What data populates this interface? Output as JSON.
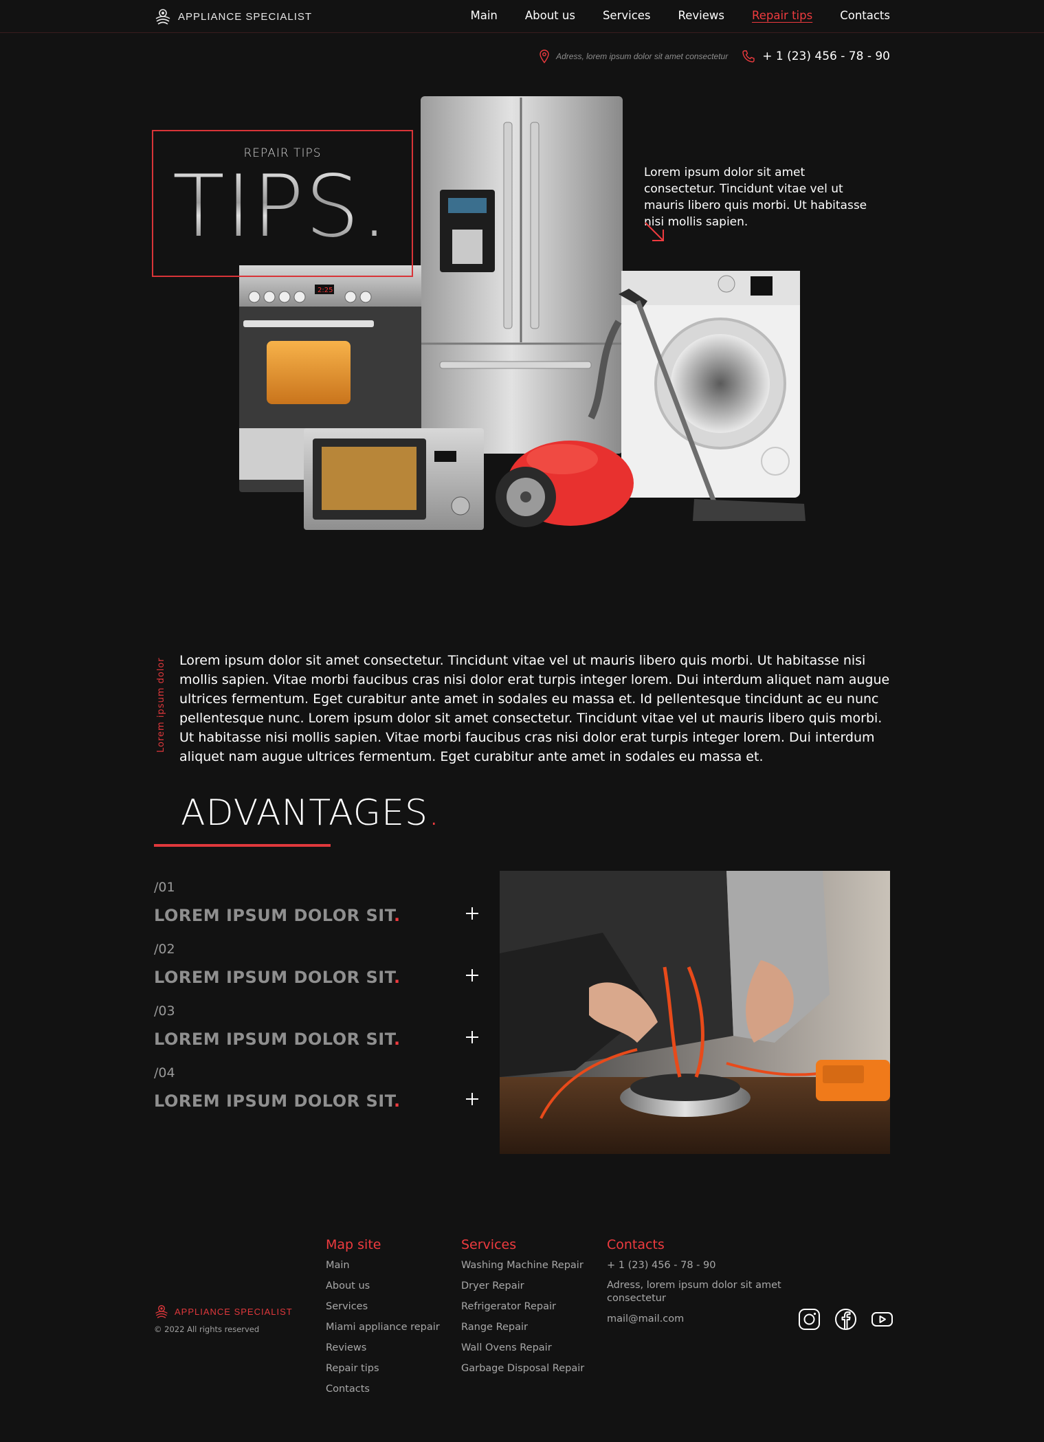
{
  "header": {
    "logo_text": "APPLIANCE SPECIALIST",
    "nav": [
      {
        "label": "Main"
      },
      {
        "label": "About us"
      },
      {
        "label": "Services"
      },
      {
        "label": "Reviews"
      },
      {
        "label": "Repair tips",
        "active": true
      },
      {
        "label": "Contacts"
      }
    ]
  },
  "contact_bar": {
    "address": "Adress, lorem ipsum dolor sit amet consectetur",
    "phone": "+ 1 (23) 456 - 78 - 90"
  },
  "hero": {
    "subtitle": "REPAIR TIPS",
    "title": "TIPS",
    "title_dot": ".",
    "side_text": "Lorem ipsum dolor sit amet consectetur. Tincidunt vitae vel ut mauris libero quis morbi. Ut habitasse nisi mollis sapien."
  },
  "about": {
    "vertical_label": "Lorem ipsum dolor",
    "text": "Lorem ipsum dolor sit amet consectetur. Tincidunt vitae vel ut mauris libero quis morbi. Ut habitasse nisi mollis sapien. Vitae morbi faucibus cras nisi dolor erat turpis integer lorem. Dui interdum aliquet nam augue ultrices fermentum. Eget curabitur ante amet in sodales eu massa et. Id pellentesque tincidunt ac eu nunc pellentesque nunc. Lorem ipsum dolor sit amet consectetur. Tincidunt vitae vel ut mauris libero quis morbi. Ut habitasse nisi mollis sapien. Vitae morbi faucibus cras nisi dolor erat turpis integer lorem. Dui interdum aliquet nam augue ultrices fermentum. Eget curabitur ante amet in sodales eu massa et."
  },
  "advantages": {
    "title": "ADVANTAGES",
    "title_dot": ".",
    "items": [
      {
        "num": "/01",
        "label": "LOREM IPSUM DOLOR SIT",
        "dot": "."
      },
      {
        "num": "/02",
        "label": "LOREM IPSUM DOLOR SIT",
        "dot": "."
      },
      {
        "num": "/03",
        "label": "LOREM IPSUM DOLOR SIT",
        "dot": "."
      },
      {
        "num": "/04",
        "label": "LOREM IPSUM DOLOR SIT",
        "dot": "."
      }
    ]
  },
  "footer": {
    "logo_text": "APPLIANCE SPECIALIST",
    "copyright": "© 2022 All rights reserved",
    "map_site": {
      "title": "Map site",
      "links": [
        "Main",
        "About us",
        "Services",
        "Miami appliance repair",
        "Reviews",
        "Repair tips",
        "Contacts"
      ]
    },
    "services": {
      "title": "Services",
      "links": [
        "Washing Machine Repair",
        "Dryer Repair",
        "Refrigerator Repair",
        "Range Repair",
        "Wall Ovens Repair",
        "Garbage Disposal Repair"
      ]
    },
    "contacts": {
      "title": "Contacts",
      "phone": "+ 1 (23) 456 - 78 - 90",
      "address": "Adress, lorem ipsum dolor sit amet consectetur",
      "email": "mail@mail.com"
    },
    "social": [
      "instagram-icon",
      "facebook-icon",
      "youtube-icon"
    ]
  },
  "colors": {
    "background": "#121212",
    "accent": "#ef3b3f"
  }
}
